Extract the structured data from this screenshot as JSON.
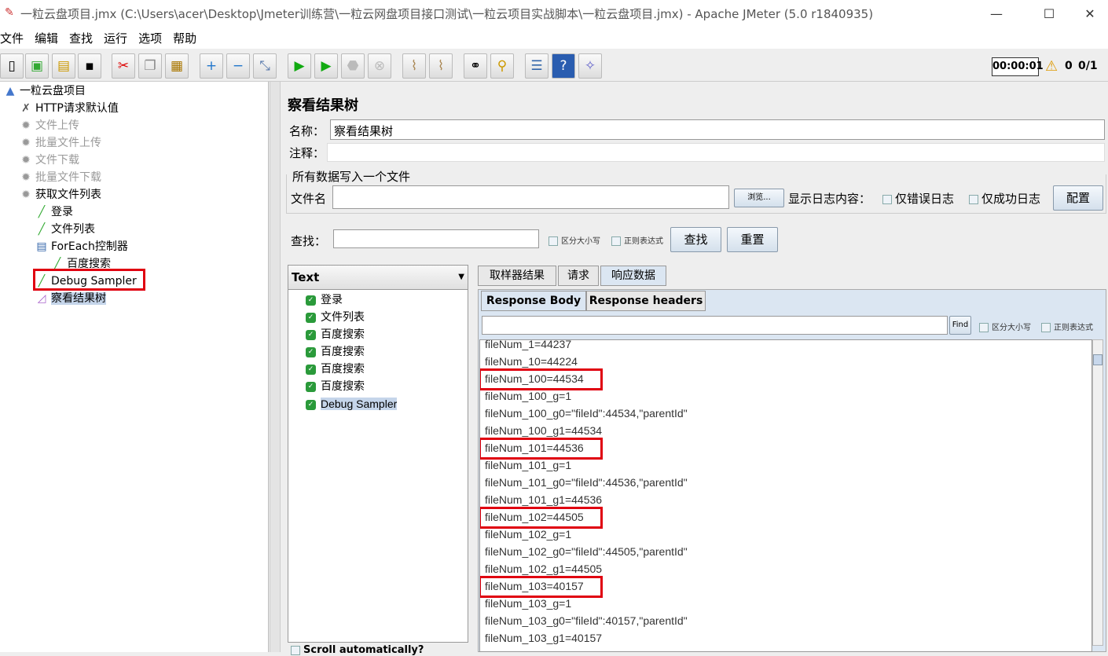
{
  "window": {
    "title": "一粒云盘项目.jmx (C:\\Users\\acer\\Desktop\\Jmeter训练营\\一粒云网盘项目接口测试\\一粒云项目实战脚本\\一粒云盘项目.jmx) - Apache JMeter (5.0 r1840935)",
    "minimize": "—",
    "maximize": "☐",
    "close": "✕"
  },
  "menu": [
    "文件",
    "编辑",
    "查找",
    "运行",
    "选项",
    "帮助"
  ],
  "toolbar": {
    "timer": "00:00:01",
    "warnings": "0",
    "threads": "0/1"
  },
  "tree": [
    {
      "label": "一粒云盘项目",
      "icon": "test-plan-icon",
      "level": 0
    },
    {
      "label": "HTTP请求默认值",
      "icon": "wrench-icon",
      "level": 1
    },
    {
      "label": "文件上传",
      "icon": "gear-icon",
      "level": 1,
      "disabled": true
    },
    {
      "label": "批量文件上传",
      "icon": "gear-icon",
      "level": 1,
      "disabled": true
    },
    {
      "label": "文件下载",
      "icon": "gear-icon",
      "level": 1,
      "disabled": true
    },
    {
      "label": "批量文件下载",
      "icon": "gear-icon",
      "level": 1,
      "disabled": true
    },
    {
      "label": "获取文件列表",
      "icon": "gear-icon",
      "level": 1
    },
    {
      "label": "登录",
      "icon": "pipette-icon",
      "level": 2
    },
    {
      "label": "文件列表",
      "icon": "pipette-icon",
      "level": 2
    },
    {
      "label": "ForEach控制器",
      "icon": "controller-icon",
      "level": 2
    },
    {
      "label": "百度搜索",
      "icon": "pipette-icon",
      "level": 3
    },
    {
      "label": "Debug Sampler",
      "icon": "pipette-icon",
      "level": 2
    },
    {
      "label": "察看结果树",
      "icon": "chart-icon",
      "level": 2,
      "selected": true
    }
  ],
  "panel": {
    "title": "察看结果树",
    "name_label": "名称：",
    "name_value": "察看结果树",
    "comment_label": "注释：",
    "file_section": "所有数据写入一个文件",
    "filename_label": "文件名",
    "browse": "浏览...",
    "log_label": "显示日志内容：",
    "errors_only": "仅错误日志",
    "success_only": "仅成功日志",
    "configure": "配置",
    "search_label": "查找：",
    "case_sensitive": "区分大小写",
    "regex": "正则表达式",
    "search_btn": "查找",
    "reset_btn": "重置"
  },
  "renderer": "Text",
  "results": [
    "登录",
    "文件列表",
    "百度搜索",
    "百度搜索",
    "百度搜索",
    "百度搜索",
    "Debug Sampler"
  ],
  "scroll_auto": "Scroll automatically?",
  "tabs": [
    "取样器结果",
    "请求",
    "响应数据"
  ],
  "subtabs": [
    "Response Body",
    "Response headers"
  ],
  "find": {
    "button": "Find",
    "case_sensitive": "区分大小写",
    "regex": "正则表达式"
  },
  "response_lines": [
    "fileNum_1=44237",
    "fileNum_10=44224",
    "fileNum_100=44534",
    "fileNum_100_g=1",
    "fileNum_100_g0=\"fileId\":44534,\"parentId\"",
    "fileNum_100_g1=44534",
    "fileNum_101=44536",
    "fileNum_101_g=1",
    "fileNum_101_g0=\"fileId\":44536,\"parentId\"",
    "fileNum_101_g1=44536",
    "fileNum_102=44505",
    "fileNum_102_g=1",
    "fileNum_102_g0=\"fileId\":44505,\"parentId\"",
    "fileNum_102_g1=44505",
    "fileNum_103=40157",
    "fileNum_103_g=1",
    "fileNum_103_g0=\"fileId\":40157,\"parentId\"",
    "fileNum_103_g1=40157"
  ],
  "colors": {
    "highlight": "#e00010",
    "selection": "#c5d5ea"
  }
}
